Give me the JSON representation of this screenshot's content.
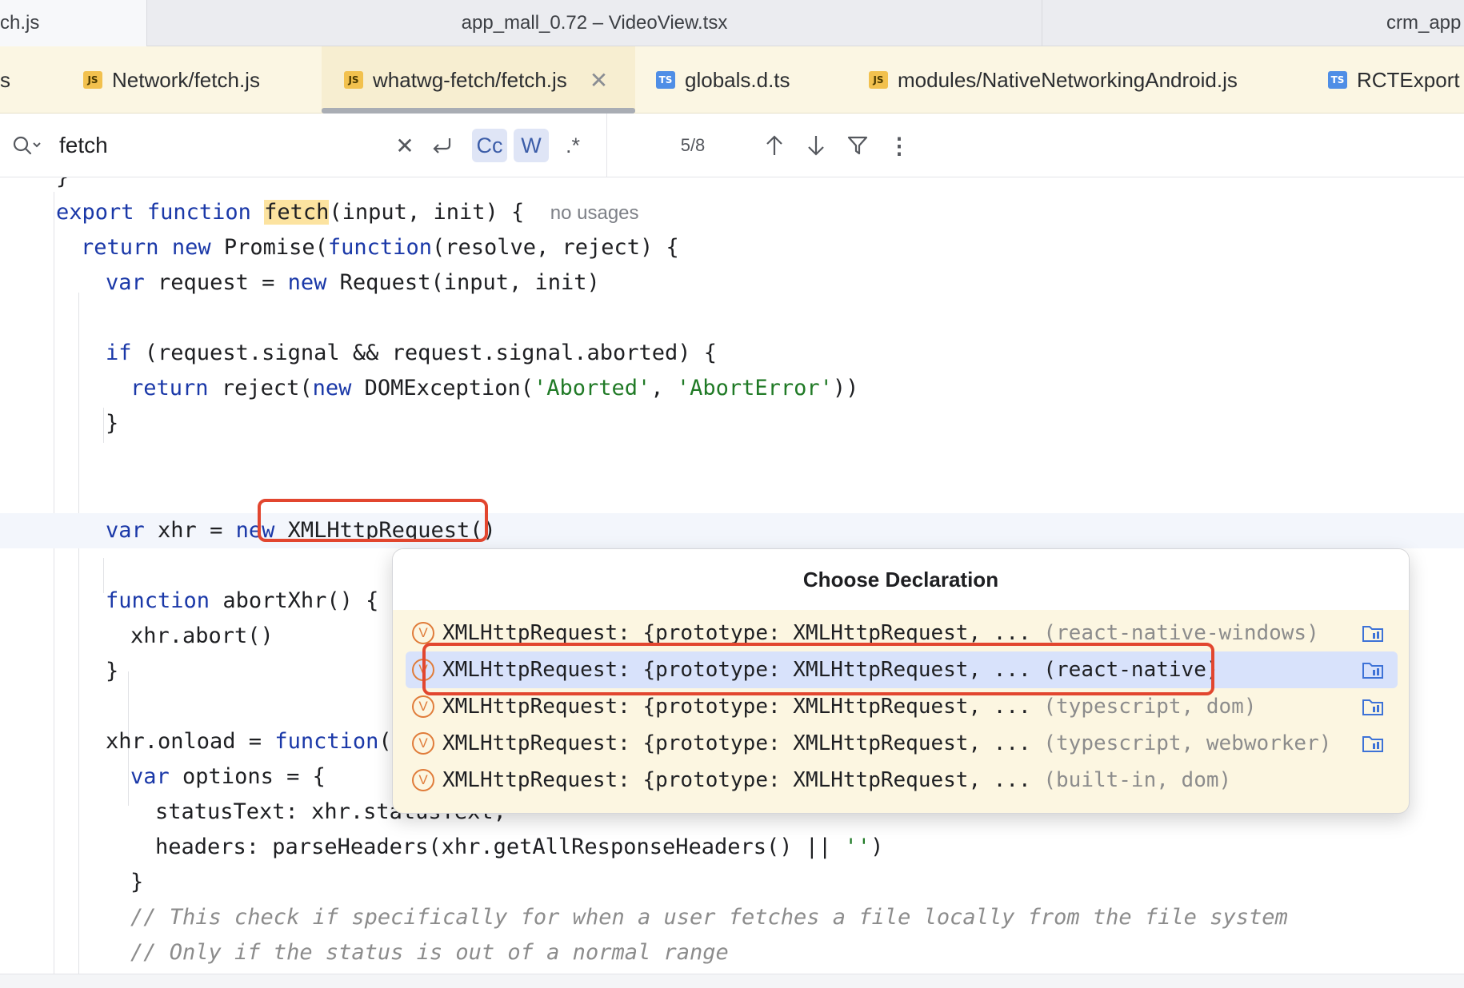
{
  "window_tabs": {
    "left": "ch.js",
    "center": "app_mall_0.72 – VideoView.tsx",
    "right": "crm_app"
  },
  "editor_tabs": [
    {
      "label": "s",
      "type": "",
      "active": false
    },
    {
      "label": "Network/fetch.js",
      "type": "JS",
      "active": false
    },
    {
      "label": "whatwg-fetch/fetch.js",
      "type": "JS",
      "active": true
    },
    {
      "label": "globals.d.ts",
      "type": "TS",
      "active": false
    },
    {
      "label": "modules/NativeNetworkingAndroid.js",
      "type": "JS",
      "active": false
    },
    {
      "label": "RCTExport",
      "type": "TS",
      "active": false
    }
  ],
  "search": {
    "query": "fetch",
    "match_count": "5/8",
    "toggles": {
      "match_case": "Cc",
      "words": "W",
      "regex": ".*"
    },
    "match_case_on": true,
    "words_on": true
  },
  "code": {
    "l0": "}",
    "l1_kw1": "export",
    "l1_kw2": "function",
    "l1_hl": "fetch",
    "l1_rest": "(input, init) {",
    "l1_hint": "no usages",
    "l2_kw1": "return",
    "l2_kw2": "new",
    "l2_mid": "Promise(",
    "l2_kw3": "function",
    "l2_rest": "(resolve, reject) {",
    "l3_kw1": "var",
    "l3_mid": "request = ",
    "l3_kw2": "new",
    "l3_rest": "Request(input, init)",
    "l5_kw1": "if",
    "l5_rest": "(request.signal && request.signal.aborted) {",
    "l6_kw1": "return",
    "l6_mid": "reject(",
    "l6_kw2": "new",
    "l6_mid2": "DOMException(",
    "l6_str1": "'Aborted'",
    "l6_sep": ", ",
    "l6_str2": "'AbortError'",
    "l6_end": "))",
    "l7": "}",
    "l9_kw1": "var",
    "l9_mid": "xhr = ",
    "l9_kw2": "new",
    "l9_rest": "XMLHttpRequest()",
    "l11_kw1": "function",
    "l11_rest": "abortXhr() {",
    "l12": "xhr.abort()",
    "l13": "}",
    "l15_mid": "xhr.onload = ",
    "l15_kw": "function",
    "l15_rest": "()",
    "l16_kw": "var",
    "l16_rest": "options = {",
    "l17": "statusText: xhr.statusText,",
    "l18_mid": "headers: parseHeaders(xhr.getAllResponseHeaders() || ",
    "l18_str": "''",
    "l18_end": ")",
    "l19": "}",
    "l20": "// This check if specifically for when a user fetches a file locally from the file system",
    "l21": "// Only if the status is out of a normal range"
  },
  "popup": {
    "title": "Choose Declaration",
    "selected_index": 1,
    "items": [
      {
        "icon": "V",
        "text": "XMLHttpRequest: {prototype: XMLHttpRequest, ... ",
        "origin": "(react-native-windows)"
      },
      {
        "icon": "V",
        "text": "XMLHttpRequest: {prototype: XMLHttpRequest, ... ",
        "origin": "(react-native)"
      },
      {
        "icon": "V",
        "text": "XMLHttpRequest: {prototype: XMLHttpRequest, ... ",
        "origin": "(typescript, dom)"
      },
      {
        "icon": "V",
        "text": "XMLHttpRequest: {prototype: XMLHttpRequest, ... ",
        "origin": "(typescript, webworker)"
      },
      {
        "icon": "V",
        "text": "XMLHttpRequest: {prototype: XMLHttpRequest, ... ",
        "origin": "(built-in, dom)"
      }
    ]
  },
  "colors": {
    "keyword": "#1a38a8",
    "string": "#207a26",
    "search_highlight": "#fce3a0",
    "annotation_red": "#e2462f",
    "selected_row": "#d8e2fb",
    "popup_bg": "#fcf6e1"
  }
}
